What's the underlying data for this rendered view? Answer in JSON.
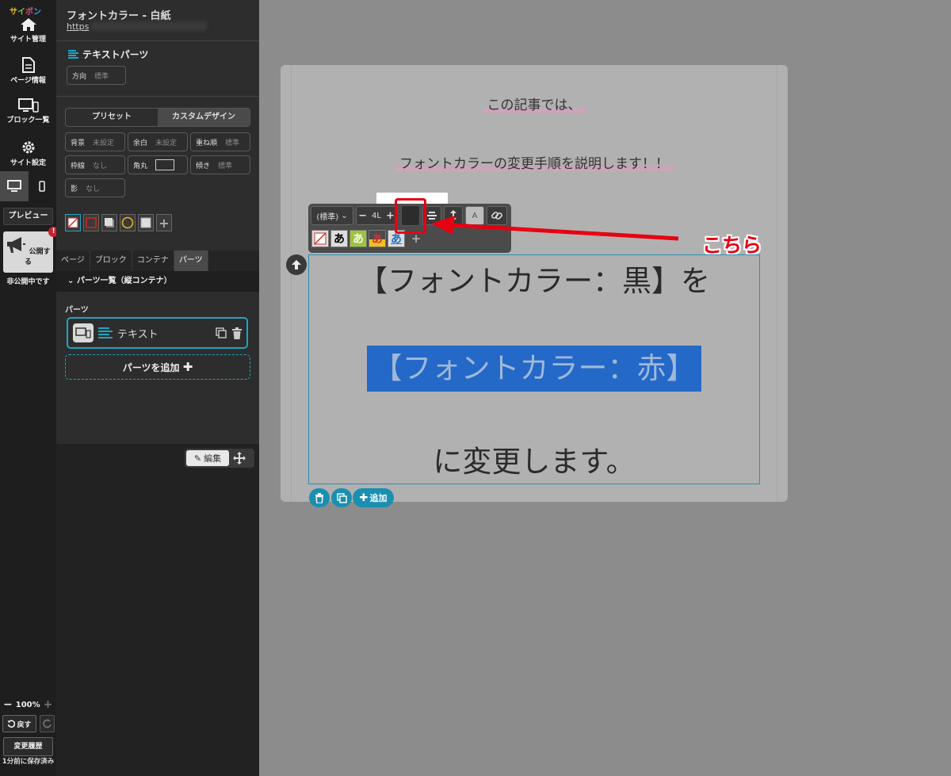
{
  "app": {
    "logo": [
      "サ",
      "イ",
      "ポ",
      "ン"
    ]
  },
  "rail": {
    "site_manage": "サイト管理",
    "page_info": "ページ情報",
    "block_list": "ブロック一覧",
    "site_settings": "サイト設定",
    "preview": "プレビュー",
    "publish": "公開する",
    "publish_badge": "!",
    "unpublished": "非公開中です",
    "zoom": "100%",
    "undo": "戻す",
    "history": "変更履歴",
    "saved": "1分前に保存済み"
  },
  "page": {
    "title": "フォントカラー - 白紙",
    "url": "https"
  },
  "panel": {
    "section_title": "テキストパーツ",
    "direction_label": "方向",
    "direction_value": "標準",
    "design_tabs": [
      "プリセット",
      "カスタムデザイン"
    ],
    "props": [
      {
        "label": "背景",
        "value": "未設定"
      },
      {
        "label": "余白",
        "value": "未設定"
      },
      {
        "label": "重ね順",
        "value": "標準"
      },
      {
        "label": "枠線",
        "value": "なし"
      },
      {
        "label": "角丸",
        "value": ""
      },
      {
        "label": "傾き",
        "value": "標準"
      },
      {
        "label": "影",
        "value": "なし"
      }
    ],
    "tabs": [
      "ページ",
      "ブロック",
      "コンテナ",
      "パーツ"
    ],
    "parts_list_title": "パーツ一覧（縦コンテナ）",
    "parts_label": "パーツ",
    "part_name": "テキスト",
    "add_part": "パーツを追加",
    "edit": "編集"
  },
  "toolbar": {
    "style_select": "(標準)",
    "line_height": "4L",
    "letter_a": "A",
    "char_glyph": "あ"
  },
  "canvas": {
    "intro_1": "この記事では、",
    "intro_2": "フォントカラーの変更手順を説明します！！",
    "line_black": "【フォントカラー：黒】を",
    "line_red": "【フォントカラー：赤】",
    "line_end": "に変更します。",
    "add": "追加"
  },
  "annotation": {
    "callout": "こちら",
    "color": "#e60012"
  },
  "colors": {
    "accent": "#1fa4c3",
    "selection": "#2468c8"
  }
}
